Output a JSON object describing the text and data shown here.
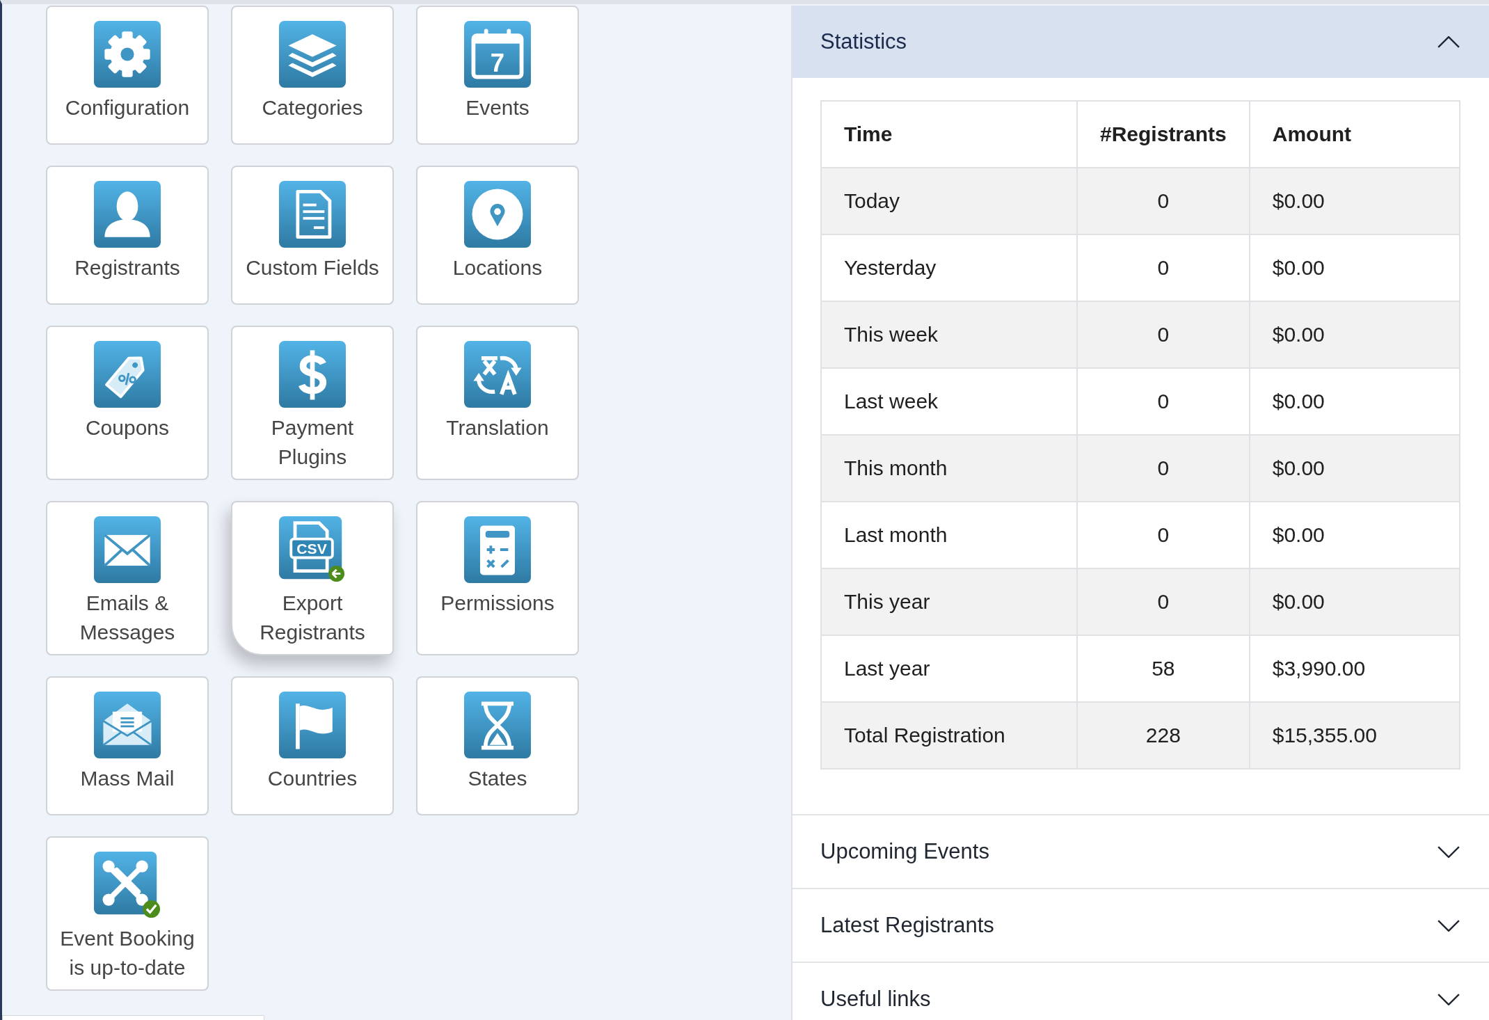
{
  "tiles": [
    {
      "label": "Configuration",
      "kind": "gear",
      "hovered": false
    },
    {
      "label": "Categories",
      "kind": "layers",
      "hovered": false
    },
    {
      "label": "Events",
      "kind": "calendar",
      "icon_text": "7",
      "hovered": false
    },
    {
      "label": "Registrants",
      "kind": "person",
      "hovered": false
    },
    {
      "label": "Custom Fields",
      "kind": "document",
      "hovered": false
    },
    {
      "label": "Locations",
      "kind": "pin",
      "hovered": false
    },
    {
      "label": "Coupons",
      "kind": "tag",
      "hovered": false
    },
    {
      "label": "Payment Plugins",
      "kind": "dollar",
      "hovered": false
    },
    {
      "label": "Translation",
      "kind": "translate",
      "hovered": false
    },
    {
      "label": "Emails & Messages",
      "kind": "envelope",
      "hovered": false
    },
    {
      "label": "Export Registrants",
      "kind": "csv",
      "icon_text": "CSV",
      "hovered": true
    },
    {
      "label": "Permissions",
      "kind": "calculator",
      "hovered": false
    },
    {
      "label": "Mass Mail",
      "kind": "open-envelope",
      "hovered": false
    },
    {
      "label": "Countries",
      "kind": "flag",
      "hovered": false
    },
    {
      "label": "States",
      "kind": "hourglass",
      "hovered": false
    },
    {
      "label": "Event Booking is up-to-date",
      "kind": "knot-check",
      "hovered": false
    }
  ],
  "panels": [
    {
      "title": "Statistics",
      "expanded": true,
      "table": {
        "columns": [
          "Time",
          "#Registrants",
          "Amount"
        ],
        "rows": [
          [
            "Today",
            "0",
            "$0.00"
          ],
          [
            "Yesterday",
            "0",
            "$0.00"
          ],
          [
            "This week",
            "0",
            "$0.00"
          ],
          [
            "Last week",
            "0",
            "$0.00"
          ],
          [
            "This month",
            "0",
            "$0.00"
          ],
          [
            "Last month",
            "0",
            "$0.00"
          ],
          [
            "This year",
            "0",
            "$0.00"
          ],
          [
            "Last year",
            "58",
            "$3,990.00"
          ],
          [
            "Total Registration",
            "228",
            "$15,355.00"
          ]
        ]
      }
    },
    {
      "title": "Upcoming Events",
      "expanded": false
    },
    {
      "title": "Latest Registrants",
      "expanded": false
    },
    {
      "title": "Useful links",
      "expanded": false
    }
  ]
}
